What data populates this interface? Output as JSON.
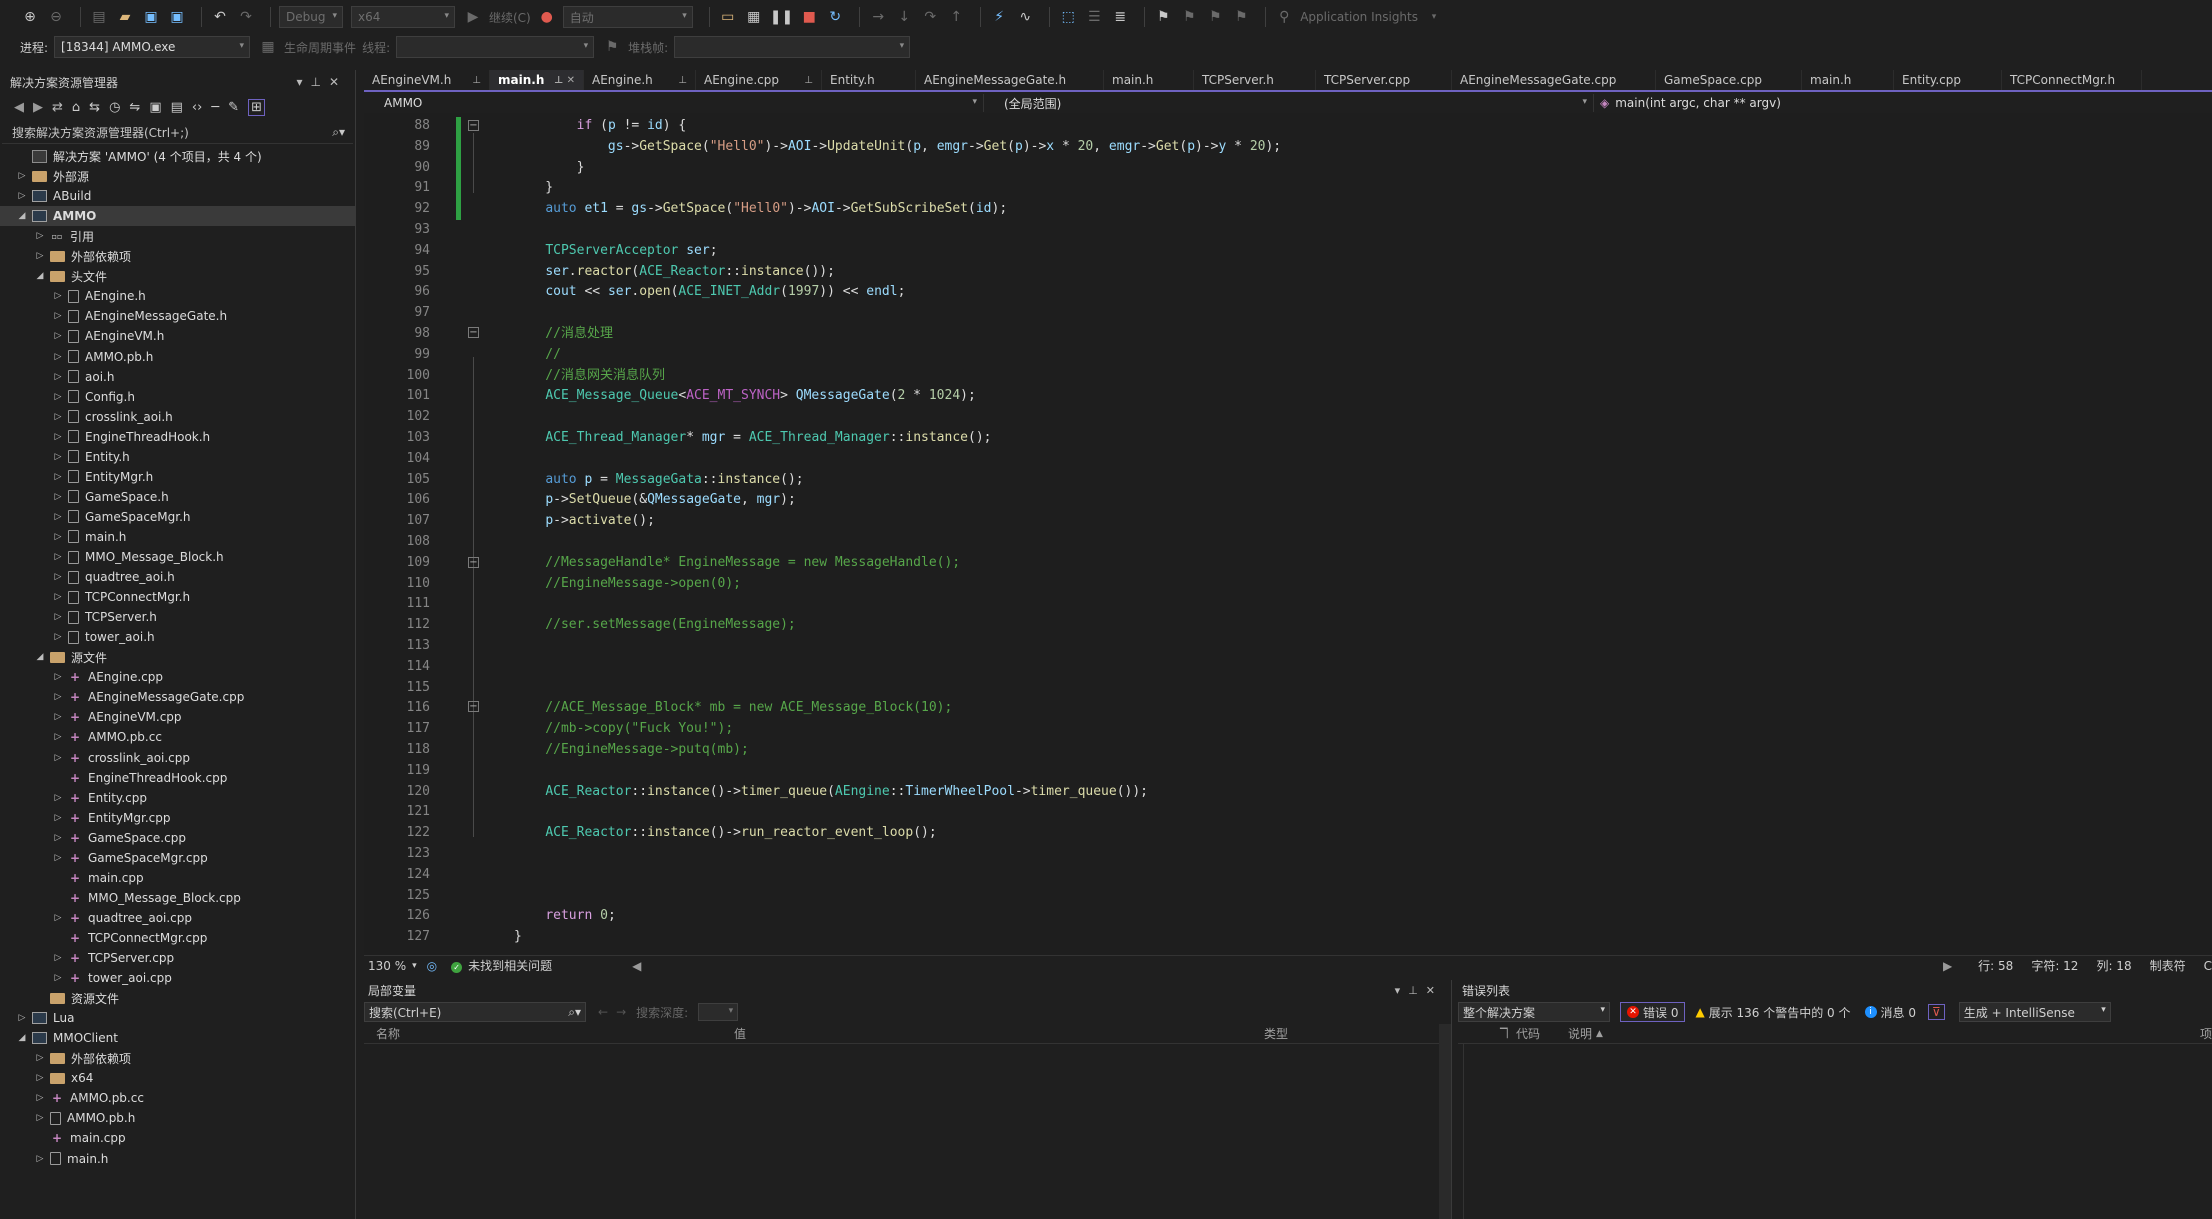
{
  "toolbar": {
    "config": "Debug",
    "platform": "x64",
    "continue_label": "继续(C)",
    "auto_label": "自动",
    "insights_label": "Application Insights",
    "process_label": "进程:",
    "process_value": "[18344] AMMO.exe",
    "lifecycle_label": "生命周期事件",
    "thread_label": "线程:",
    "stackframe_label": "堆栈帧:"
  },
  "solution_explorer": {
    "title": "解决方案资源管理器",
    "search_placeholder": "搜索解决方案资源管理器(Ctrl+;)",
    "items": [
      {
        "label": "解决方案 'AMMO' (4 个项目，共 4 个)",
        "depth": 0,
        "twisty": "",
        "icon": "sol"
      },
      {
        "label": "外部源",
        "depth": 0,
        "twisty": "▷",
        "icon": "folder"
      },
      {
        "label": "ABuild",
        "depth": 0,
        "twisty": "▷",
        "icon": "proj"
      },
      {
        "label": "AMMO",
        "depth": 0,
        "twisty": "◢",
        "icon": "proj",
        "selected": true
      },
      {
        "label": "引用",
        "depth": 1,
        "twisty": "▷",
        "icon": "ref"
      },
      {
        "label": "外部依赖项",
        "depth": 1,
        "twisty": "▷",
        "icon": "folder"
      },
      {
        "label": "头文件",
        "depth": 1,
        "twisty": "◢",
        "icon": "folder"
      },
      {
        "label": "AEngine.h",
        "depth": 2,
        "twisty": "▷",
        "icon": "h"
      },
      {
        "label": "AEngineMessageGate.h",
        "depth": 2,
        "twisty": "▷",
        "icon": "h"
      },
      {
        "label": "AEngineVM.h",
        "depth": 2,
        "twisty": "▷",
        "icon": "h"
      },
      {
        "label": "AMMO.pb.h",
        "depth": 2,
        "twisty": "▷",
        "icon": "h"
      },
      {
        "label": "aoi.h",
        "depth": 2,
        "twisty": "▷",
        "icon": "h"
      },
      {
        "label": "Config.h",
        "depth": 2,
        "twisty": "▷",
        "icon": "h"
      },
      {
        "label": "crosslink_aoi.h",
        "depth": 2,
        "twisty": "▷",
        "icon": "h"
      },
      {
        "label": "EngineThreadHook.h",
        "depth": 2,
        "twisty": "▷",
        "icon": "h"
      },
      {
        "label": "Entity.h",
        "depth": 2,
        "twisty": "▷",
        "icon": "h"
      },
      {
        "label": "EntityMgr.h",
        "depth": 2,
        "twisty": "▷",
        "icon": "h"
      },
      {
        "label": "GameSpace.h",
        "depth": 2,
        "twisty": "▷",
        "icon": "h"
      },
      {
        "label": "GameSpaceMgr.h",
        "depth": 2,
        "twisty": "▷",
        "icon": "h"
      },
      {
        "label": "main.h",
        "depth": 2,
        "twisty": "▷",
        "icon": "h"
      },
      {
        "label": "MMO_Message_Block.h",
        "depth": 2,
        "twisty": "▷",
        "icon": "h"
      },
      {
        "label": "quadtree_aoi.h",
        "depth": 2,
        "twisty": "▷",
        "icon": "h"
      },
      {
        "label": "TCPConnectMgr.h",
        "depth": 2,
        "twisty": "▷",
        "icon": "h"
      },
      {
        "label": "TCPServer.h",
        "depth": 2,
        "twisty": "▷",
        "icon": "h"
      },
      {
        "label": "tower_aoi.h",
        "depth": 2,
        "twisty": "▷",
        "icon": "h"
      },
      {
        "label": "源文件",
        "depth": 1,
        "twisty": "◢",
        "icon": "folder"
      },
      {
        "label": "AEngine.cpp",
        "depth": 2,
        "twisty": "▷",
        "icon": "cpp"
      },
      {
        "label": "AEngineMessageGate.cpp",
        "depth": 2,
        "twisty": "▷",
        "icon": "cpp"
      },
      {
        "label": "AEngineVM.cpp",
        "depth": 2,
        "twisty": "▷",
        "icon": "cpp"
      },
      {
        "label": "AMMO.pb.cc",
        "depth": 2,
        "twisty": "▷",
        "icon": "cpp"
      },
      {
        "label": "crosslink_aoi.cpp",
        "depth": 2,
        "twisty": "▷",
        "icon": "cpp"
      },
      {
        "label": "EngineThreadHook.cpp",
        "depth": 2,
        "twisty": "",
        "icon": "cpp"
      },
      {
        "label": "Entity.cpp",
        "depth": 2,
        "twisty": "▷",
        "icon": "cpp"
      },
      {
        "label": "EntityMgr.cpp",
        "depth": 2,
        "twisty": "▷",
        "icon": "cpp"
      },
      {
        "label": "GameSpace.cpp",
        "depth": 2,
        "twisty": "▷",
        "icon": "cpp"
      },
      {
        "label": "GameSpaceMgr.cpp",
        "depth": 2,
        "twisty": "▷",
        "icon": "cpp"
      },
      {
        "label": "main.cpp",
        "depth": 2,
        "twisty": "",
        "icon": "cpp"
      },
      {
        "label": "MMO_Message_Block.cpp",
        "depth": 2,
        "twisty": "",
        "icon": "cpp"
      },
      {
        "label": "quadtree_aoi.cpp",
        "depth": 2,
        "twisty": "▷",
        "icon": "cpp"
      },
      {
        "label": "TCPConnectMgr.cpp",
        "depth": 2,
        "twisty": "",
        "icon": "cpp"
      },
      {
        "label": "TCPServer.cpp",
        "depth": 2,
        "twisty": "▷",
        "icon": "cpp"
      },
      {
        "label": "tower_aoi.cpp",
        "depth": 2,
        "twisty": "▷",
        "icon": "cpp"
      },
      {
        "label": "资源文件",
        "depth": 1,
        "twisty": "",
        "icon": "folder"
      },
      {
        "label": "Lua",
        "depth": 0,
        "twisty": "▷",
        "icon": "proj"
      },
      {
        "label": "MMOClient",
        "depth": 0,
        "twisty": "◢",
        "icon": "proj"
      },
      {
        "label": "外部依赖项",
        "depth": 1,
        "twisty": "▷",
        "icon": "folder"
      },
      {
        "label": "x64",
        "depth": 1,
        "twisty": "▷",
        "icon": "folder"
      },
      {
        "label": "AMMO.pb.cc",
        "depth": 1,
        "twisty": "▷",
        "icon": "cpp"
      },
      {
        "label": "AMMO.pb.h",
        "depth": 1,
        "twisty": "▷",
        "icon": "h"
      },
      {
        "label": "main.cpp",
        "depth": 1,
        "twisty": "",
        "icon": "cpp"
      },
      {
        "label": "main.h",
        "depth": 1,
        "twisty": "▷",
        "icon": "h"
      }
    ]
  },
  "tabs": [
    {
      "label": "AEngineVM.h",
      "pinned": true
    },
    {
      "label": "main.h",
      "active": true
    },
    {
      "label": "AEngine.h",
      "pinned": true
    },
    {
      "label": "AEngine.cpp",
      "pinned": true
    },
    {
      "label": "Entity.h"
    },
    {
      "label": "AEngineMessageGate.h"
    },
    {
      "label": "main.h"
    },
    {
      "label": "TCPServer.h"
    },
    {
      "label": "TCPServer.cpp"
    },
    {
      "label": "AEngineMessageGate.cpp"
    },
    {
      "label": "GameSpace.cpp"
    },
    {
      "label": "main.h"
    },
    {
      "label": "Entity.cpp"
    },
    {
      "label": "TCPConnectMgr.h"
    }
  ],
  "navbar": {
    "project": "AMMO",
    "scope": "(全局范围)",
    "function": "main(int argc, char ** argv)"
  },
  "code_lines": [
    {
      "n": "88",
      "t": "        if (p != id) {"
    },
    {
      "n": "89",
      "t": "            gs->GetSpace(\"Hell0\")->AOI->UpdateUnit(p, emgr->Get(p)->x * 20, emgr->Get(p)->y * 20);"
    },
    {
      "n": "90",
      "t": "        }"
    },
    {
      "n": "91",
      "t": "    }"
    },
    {
      "n": "92",
      "t": "    auto et1 = gs->GetSpace(\"Hell0\")->AOI->GetSubScribeSet(id);"
    },
    {
      "n": "93",
      "t": ""
    },
    {
      "n": "94",
      "t": "    TCPServerAcceptor ser;"
    },
    {
      "n": "95",
      "t": "    ser.reactor(ACE_Reactor::instance());"
    },
    {
      "n": "96",
      "t": "    cout << ser.open(ACE_INET_Addr(1997)) << endl;"
    },
    {
      "n": "97",
      "t": ""
    },
    {
      "n": "98",
      "t": "    //消息处理"
    },
    {
      "n": "99",
      "t": "    //"
    },
    {
      "n": "100",
      "t": "    //消息网关消息队列"
    },
    {
      "n": "101",
      "t": "    ACE_Message_Queue<ACE_MT_SYNCH> QMessageGate(2 * 1024);"
    },
    {
      "n": "102",
      "t": ""
    },
    {
      "n": "103",
      "t": "    ACE_Thread_Manager* mgr = ACE_Thread_Manager::instance();"
    },
    {
      "n": "104",
      "t": ""
    },
    {
      "n": "105",
      "t": "    auto p = MessageGata::instance();"
    },
    {
      "n": "106",
      "t": "    p->SetQueue(&QMessageGate, mgr);"
    },
    {
      "n": "107",
      "t": "    p->activate();"
    },
    {
      "n": "108",
      "t": ""
    },
    {
      "n": "109",
      "t": "    //MessageHandle* EngineMessage = new MessageHandle();"
    },
    {
      "n": "110",
      "t": "    //EngineMessage->open(0);"
    },
    {
      "n": "111",
      "t": ""
    },
    {
      "n": "112",
      "t": "    //ser.setMessage(EngineMessage);"
    },
    {
      "n": "113",
      "t": ""
    },
    {
      "n": "114",
      "t": ""
    },
    {
      "n": "115",
      "t": ""
    },
    {
      "n": "116",
      "t": "    //ACE_Message_Block* mb = new ACE_Message_Block(10);"
    },
    {
      "n": "117",
      "t": "    //mb->copy(\"Fuck You!\");"
    },
    {
      "n": "118",
      "t": "    //EngineMessage->putq(mb);"
    },
    {
      "n": "119",
      "t": ""
    },
    {
      "n": "120",
      "t": "    ACE_Reactor::instance()->timer_queue(AEngine::TimerWheelPool->timer_queue());"
    },
    {
      "n": "121",
      "t": ""
    },
    {
      "n": "122",
      "t": "    ACE_Reactor::instance()->run_reactor_event_loop();"
    },
    {
      "n": "123",
      "t": ""
    },
    {
      "n": "124",
      "t": ""
    },
    {
      "n": "125",
      "t": ""
    },
    {
      "n": "126",
      "t": "    return 0;"
    },
    {
      "n": "127",
      "t": "}"
    }
  ],
  "editor_status": {
    "zoom": "130 %",
    "issues": "未找到相关问题",
    "line": "行: 58",
    "char": "字符: 12",
    "col": "列: 18",
    "tab_mode": "制表符",
    "crlf": "C"
  },
  "locals": {
    "title": "局部变量",
    "search_placeholder": "搜索(Ctrl+E)",
    "search_depth_label": "搜索深度:",
    "columns": [
      "名称",
      "值",
      "类型"
    ]
  },
  "errors": {
    "title": "错误列表",
    "scope": "整个解决方案",
    "errors_label": "错误 0",
    "warnings_label": "展示 136 个警告中的 0 个",
    "messages_label": "消息 0",
    "build_filter": "生成 + IntelliSense",
    "columns": [
      "代码",
      "说明",
      "项"
    ]
  }
}
